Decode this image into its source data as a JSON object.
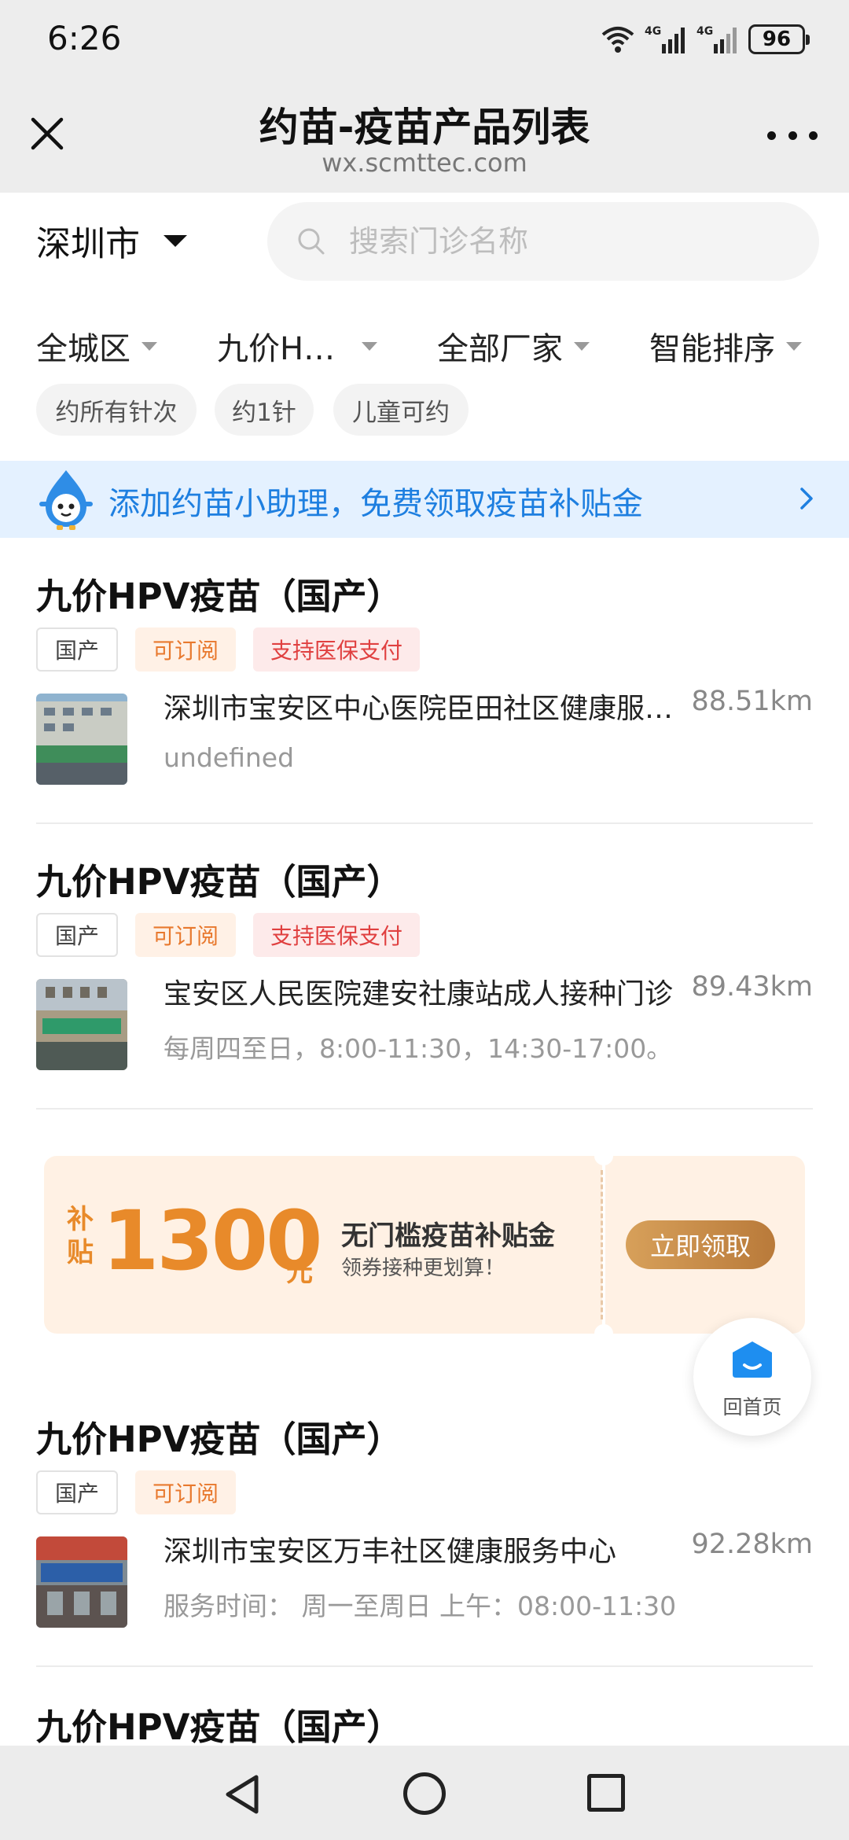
{
  "status_bar": {
    "time": "6:26",
    "battery": "96",
    "signal1": "4G",
    "signal2": "4G"
  },
  "header": {
    "title": "约苗-疫苗产品列表",
    "domain": "wx.scmttec.com"
  },
  "search": {
    "city": "深圳市",
    "placeholder": "搜索门诊名称"
  },
  "filters": {
    "district": "全城区",
    "vaccine": "九价H…",
    "manufacturer": "全部厂家",
    "sort": "智能排序"
  },
  "chips": [
    "约所有针次",
    "约1针",
    "儿童可约"
  ],
  "banner": {
    "text": "添加约苗小助理，免费领取疫苗补贴金"
  },
  "cards": [
    {
      "title": "九价HPV疫苗（国产）",
      "tags": [
        "国产",
        "可订阅",
        "支持医保支付"
      ],
      "clinic": "深圳市宝安区中心医院臣田社区健康服务中心",
      "distance": "88.51km",
      "hours": "undefined"
    },
    {
      "title": "九价HPV疫苗（国产）",
      "tags": [
        "国产",
        "可订阅",
        "支持医保支付"
      ],
      "clinic": "宝安区人民医院建安社康站成人接种门诊",
      "distance": "89.43km",
      "hours": "每周四至日，8:00-11:30，14:30-17:00。"
    },
    {
      "title": "九价HPV疫苗（国产）",
      "tags": [
        "国产",
        "可订阅"
      ],
      "clinic": "深圳市宝安区万丰社区健康服务中心",
      "distance": "92.28km",
      "hours": "服务时间：  周一至周日 上午：08:00-11:30"
    },
    {
      "title": "九价HPV疫苗（国产）"
    }
  ],
  "coupon": {
    "label_top": "补",
    "label_bottom": "贴",
    "amount": "1300",
    "unit": "元",
    "title": "无门槛疫苗补贴金",
    "subtitle": "领券接种更划算！",
    "button": "立即领取"
  },
  "home_fab": {
    "label": "回首页"
  },
  "colors": {
    "accent_blue": "#1e7fe0",
    "coupon_orange": "#e88a2a",
    "tag_red": "#e04040",
    "tag_orange": "#e8792e"
  }
}
